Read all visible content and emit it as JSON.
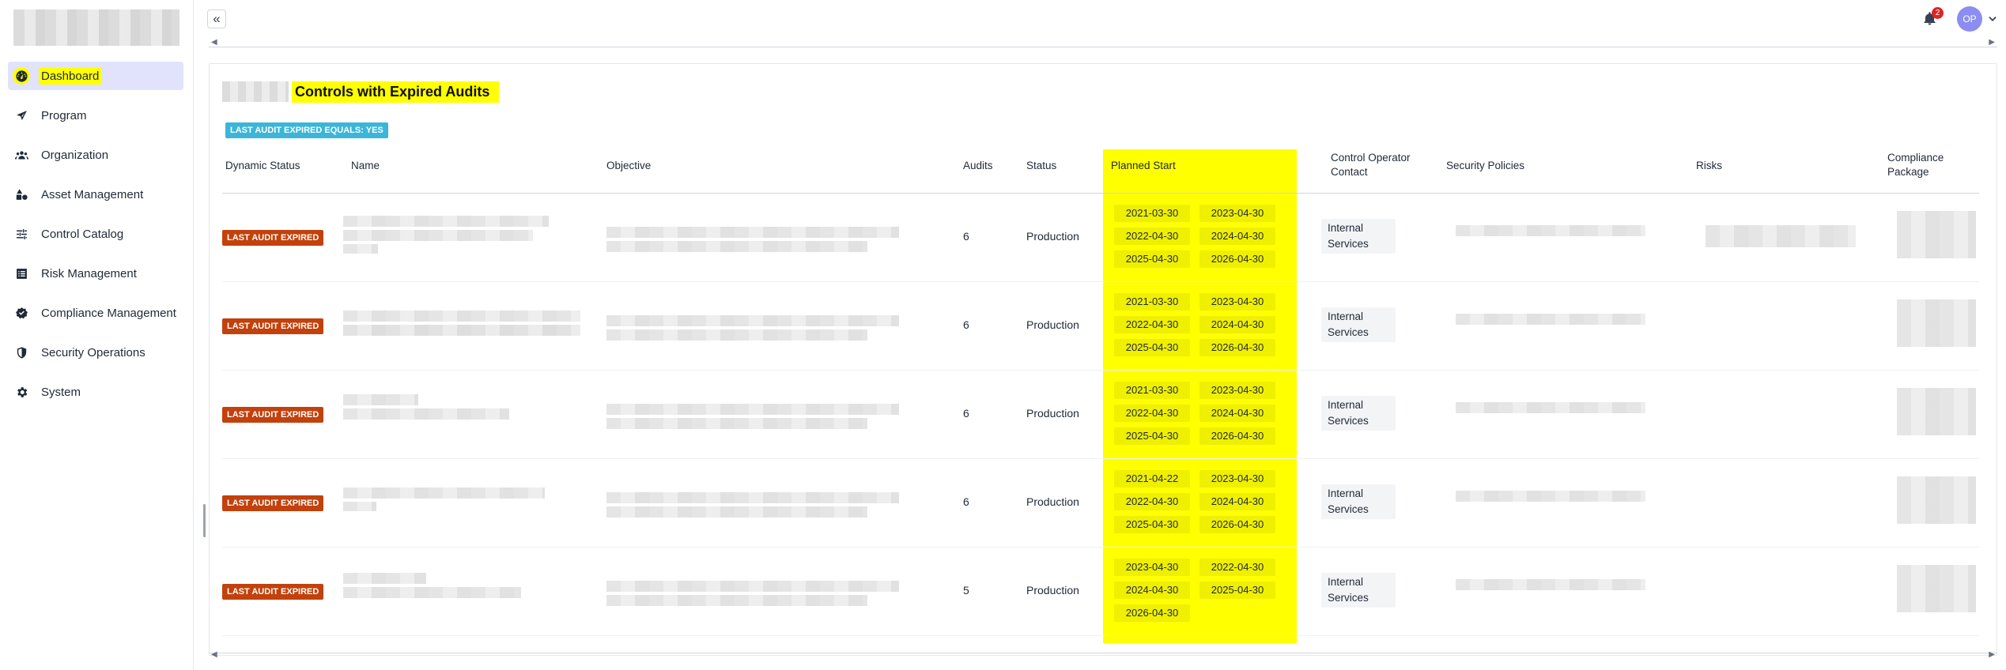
{
  "sidebar": {
    "items": [
      {
        "label": "Dashboard",
        "icon": "dashboard-icon",
        "active": true
      },
      {
        "label": "Program",
        "icon": "send-icon"
      },
      {
        "label": "Organization",
        "icon": "users-icon"
      },
      {
        "label": "Asset Management",
        "icon": "shapes-icon"
      },
      {
        "label": "Control Catalog",
        "icon": "sliders-icon"
      },
      {
        "label": "Risk Management",
        "icon": "list-icon"
      },
      {
        "label": "Compliance Management",
        "icon": "check-badge-icon"
      },
      {
        "label": "Security Operations",
        "icon": "shield-icon"
      },
      {
        "label": "System",
        "icon": "gear-icon"
      }
    ]
  },
  "topbar": {
    "collapse_label": "«",
    "notification_count": "2",
    "avatar_initials": "OP"
  },
  "card": {
    "title": "Controls with Expired Audits",
    "filter_chip": "LAST AUDIT EXPIRED EQUALS: YES",
    "highlight_color": "#ffff00"
  },
  "table": {
    "headers": {
      "dynamic_status": "Dynamic Status",
      "name": "Name",
      "objective": "Objective",
      "audits": "Audits",
      "status": "Status",
      "planned_start": "Planned Start",
      "contact_1": "Control Operator",
      "contact_2": "Contact",
      "security_policies": "Security Policies",
      "risks": "Risks",
      "package_1": "Compliance",
      "package_2": "Package"
    },
    "rows": [
      {
        "dynamic_status": "LAST AUDIT EXPIRED",
        "audits": "6",
        "status": "Production",
        "dates": [
          "2021-03-30",
          "2023-04-30",
          "2022-04-30",
          "2024-04-30",
          "2025-04-30",
          "2026-04-30"
        ],
        "contact_1": "Internal",
        "contact_2": "Services"
      },
      {
        "dynamic_status": "LAST AUDIT EXPIRED",
        "audits": "6",
        "status": "Production",
        "dates": [
          "2021-03-30",
          "2023-04-30",
          "2022-04-30",
          "2024-04-30",
          "2025-04-30",
          "2026-04-30"
        ],
        "contact_1": "Internal",
        "contact_2": "Services"
      },
      {
        "dynamic_status": "LAST AUDIT EXPIRED",
        "audits": "6",
        "status": "Production",
        "dates": [
          "2021-03-30",
          "2023-04-30",
          "2022-04-30",
          "2024-04-30",
          "2025-04-30",
          "2026-04-30"
        ],
        "contact_1": "Internal",
        "contact_2": "Services"
      },
      {
        "dynamic_status": "LAST AUDIT EXPIRED",
        "audits": "6",
        "status": "Production",
        "dates": [
          "2021-04-22",
          "2023-04-30",
          "2022-04-30",
          "2024-04-30",
          "2025-04-30",
          "2026-04-30"
        ],
        "contact_1": "Internal",
        "contact_2": "Services"
      },
      {
        "dynamic_status": "LAST AUDIT EXPIRED",
        "audits": "5",
        "status": "Production",
        "dates": [
          "2023-04-30",
          "2022-04-30",
          "2024-04-30",
          "2025-04-30",
          "2026-04-30"
        ],
        "contact_1": "Internal",
        "contact_2": "Services"
      }
    ]
  }
}
